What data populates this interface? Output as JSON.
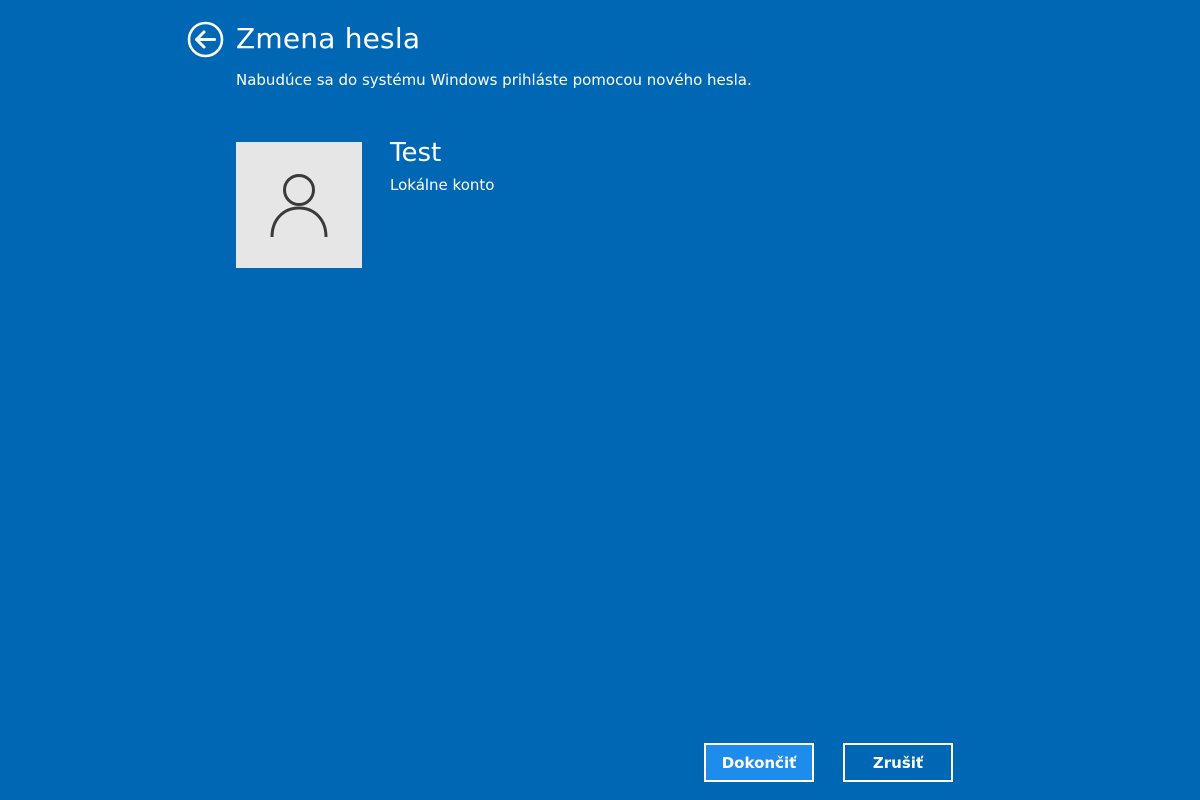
{
  "header": {
    "back_icon": "back-arrow-circle-icon",
    "title": "Zmena hesla",
    "subtitle": "Nabudúce sa do systému Windows prihláste pomocou nového hesla."
  },
  "account": {
    "avatar_icon": "user-silhouette-icon",
    "name": "Test",
    "type": "Lokálne konto"
  },
  "footer": {
    "finish_label": "Dokončiť",
    "cancel_label": "Zrušiť"
  },
  "colors": {
    "background": "#0067b5",
    "primary_button": "#1d8ceb",
    "avatar_background": "#e6e6e6",
    "text": "#ffffff"
  }
}
